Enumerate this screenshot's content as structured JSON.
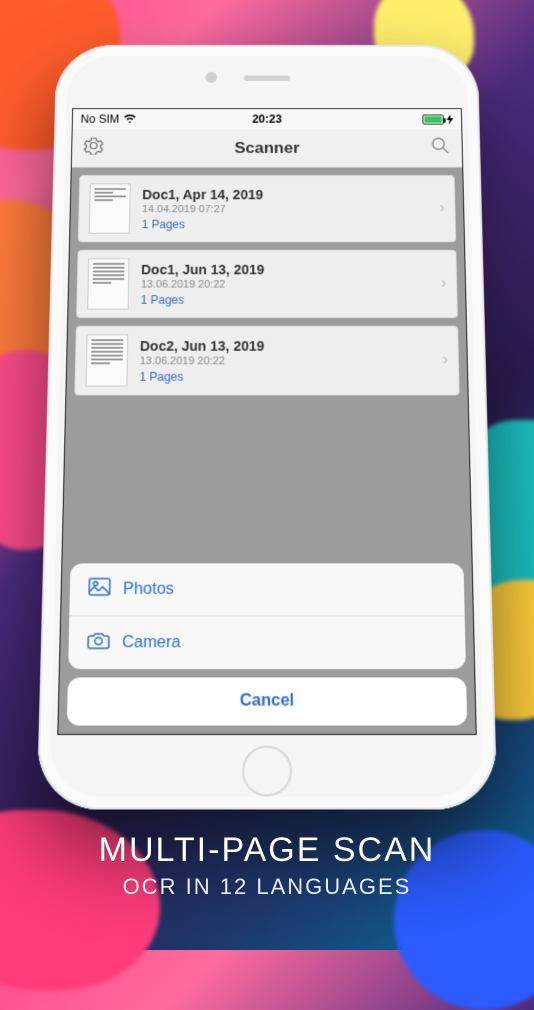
{
  "statusBar": {
    "carrier": "No SIM",
    "time": "20:23"
  },
  "nav": {
    "title": "Scanner"
  },
  "docs": [
    {
      "title": "Doc1, Apr 14, 2019",
      "date": "14.04.2019  07:27",
      "pages": "1 Pages"
    },
    {
      "title": "Doc1, Jun 13, 2019",
      "date": "13.06.2019  20:22",
      "pages": "1 Pages"
    },
    {
      "title": "Doc2, Jun 13, 2019",
      "date": "13.06.2019  20:22",
      "pages": "1 Pages"
    }
  ],
  "actionSheet": {
    "photos": "Photos",
    "camera": "Camera",
    "cancel": "Cancel"
  },
  "marketing": {
    "headline": "MULTI-PAGE SCAN",
    "subline": "OCR IN 12 LANGUAGES"
  }
}
